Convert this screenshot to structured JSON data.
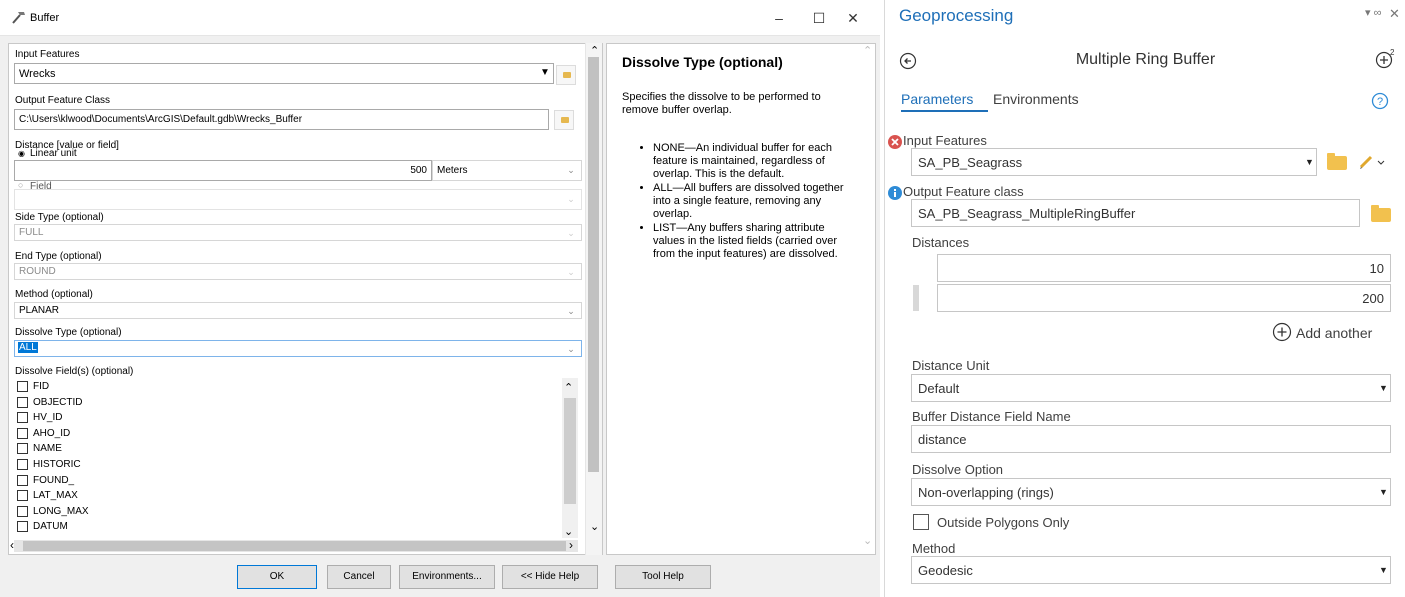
{
  "buffer": {
    "title": "Buffer",
    "input_features": {
      "label": "Input Features",
      "value": "Wrecks"
    },
    "output_feature_class": {
      "label": "Output Feature Class",
      "value": "C:\\Users\\klwood\\Documents\\ArcGIS\\Default.gdb\\Wrecks_Buffer"
    },
    "distance": {
      "label": "Distance [value or field]",
      "linear_unit_label": "Linear unit",
      "value": "500",
      "unit": "Meters",
      "field_label": "Field"
    },
    "side_type": {
      "label": "Side Type (optional)",
      "value": "FULL"
    },
    "end_type": {
      "label": "End Type (optional)",
      "value": "ROUND"
    },
    "method": {
      "label": "Method (optional)",
      "value": "PLANAR"
    },
    "dissolve_type": {
      "label": "Dissolve Type (optional)",
      "value": "ALL"
    },
    "dissolve_fields": {
      "label": "Dissolve Field(s) (optional)",
      "items": [
        "FID",
        "OBJECTID",
        "HV_ID",
        "AHO_ID",
        "NAME",
        "HISTORIC",
        "FOUND_",
        "LAT_MAX",
        "LONG_MAX",
        "DATUM"
      ]
    },
    "help": {
      "title": "Dissolve Type (optional)",
      "intro": "Specifies the dissolve to be performed to remove buffer overlap.",
      "bullets": [
        "NONE—An individual buffer for each feature is maintained, regardless of overlap. This is the default.",
        "ALL—All buffers are dissolved together into a single feature, removing any overlap.",
        "LIST—Any buffers sharing attribute values in the listed fields (carried over from the input features) are dissolved."
      ]
    },
    "buttons": {
      "ok": "OK",
      "cancel": "Cancel",
      "environments": "Environments...",
      "hide_help": "<< Hide Help",
      "tool_help": "Tool Help"
    }
  },
  "geoprocessing": {
    "pane_title": "Geoprocessing",
    "tool_title": "Multiple Ring Buffer",
    "tabs": {
      "parameters": "Parameters",
      "environments": "Environments"
    },
    "input_features": {
      "label": "Input Features",
      "value": "SA_PB_Seagrass"
    },
    "output_feature_class": {
      "label": "Output Feature class",
      "value": "SA_PB_Seagrass_MultipleRingBuffer"
    },
    "distances": {
      "label": "Distances",
      "values": [
        "10",
        "200"
      ],
      "add_another": "Add another"
    },
    "distance_unit": {
      "label": "Distance Unit",
      "value": "Default"
    },
    "buffer_distance_field": {
      "label": "Buffer Distance Field Name",
      "value": "distance"
    },
    "dissolve_option": {
      "label": "Dissolve Option",
      "value": "Non-overlapping (rings)"
    },
    "outside_polygons_only": {
      "label": "Outside Polygons Only",
      "checked": false
    },
    "method": {
      "label": "Method",
      "value": "Geodesic"
    },
    "colors": {
      "accent": "#1e6fb8",
      "error": "#d9534f",
      "info": "#2e8bd6",
      "folder": "#f2c14e"
    }
  }
}
